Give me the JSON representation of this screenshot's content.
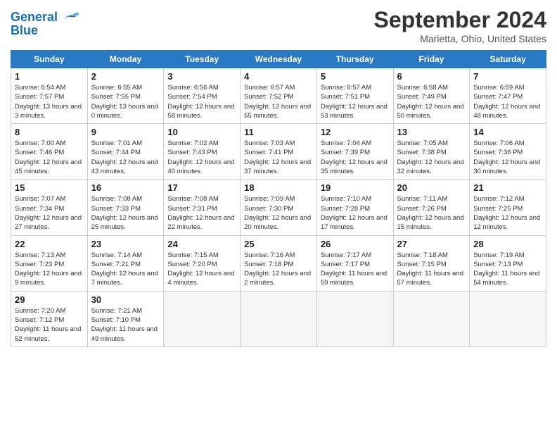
{
  "header": {
    "logo_line1": "General",
    "logo_line2": "Blue",
    "month_title": "September 2024",
    "location": "Marietta, Ohio, United States"
  },
  "days_of_week": [
    "Sunday",
    "Monday",
    "Tuesday",
    "Wednesday",
    "Thursday",
    "Friday",
    "Saturday"
  ],
  "weeks": [
    [
      {
        "day": 1,
        "sunrise": "6:54 AM",
        "sunset": "7:57 PM",
        "daylight": "13 hours and 3 minutes."
      },
      {
        "day": 2,
        "sunrise": "6:55 AM",
        "sunset": "7:55 PM",
        "daylight": "13 hours and 0 minutes."
      },
      {
        "day": 3,
        "sunrise": "6:56 AM",
        "sunset": "7:54 PM",
        "daylight": "12 hours and 58 minutes."
      },
      {
        "day": 4,
        "sunrise": "6:57 AM",
        "sunset": "7:52 PM",
        "daylight": "12 hours and 55 minutes."
      },
      {
        "day": 5,
        "sunrise": "6:57 AM",
        "sunset": "7:51 PM",
        "daylight": "12 hours and 53 minutes."
      },
      {
        "day": 6,
        "sunrise": "6:58 AM",
        "sunset": "7:49 PM",
        "daylight": "12 hours and 50 minutes."
      },
      {
        "day": 7,
        "sunrise": "6:59 AM",
        "sunset": "7:47 PM",
        "daylight": "12 hours and 48 minutes."
      }
    ],
    [
      {
        "day": 8,
        "sunrise": "7:00 AM",
        "sunset": "7:46 PM",
        "daylight": "12 hours and 45 minutes."
      },
      {
        "day": 9,
        "sunrise": "7:01 AM",
        "sunset": "7:44 PM",
        "daylight": "12 hours and 43 minutes."
      },
      {
        "day": 10,
        "sunrise": "7:02 AM",
        "sunset": "7:43 PM",
        "daylight": "12 hours and 40 minutes."
      },
      {
        "day": 11,
        "sunrise": "7:03 AM",
        "sunset": "7:41 PM",
        "daylight": "12 hours and 37 minutes."
      },
      {
        "day": 12,
        "sunrise": "7:04 AM",
        "sunset": "7:39 PM",
        "daylight": "12 hours and 35 minutes."
      },
      {
        "day": 13,
        "sunrise": "7:05 AM",
        "sunset": "7:38 PM",
        "daylight": "12 hours and 32 minutes."
      },
      {
        "day": 14,
        "sunrise": "7:06 AM",
        "sunset": "7:36 PM",
        "daylight": "12 hours and 30 minutes."
      }
    ],
    [
      {
        "day": 15,
        "sunrise": "7:07 AM",
        "sunset": "7:34 PM",
        "daylight": "12 hours and 27 minutes."
      },
      {
        "day": 16,
        "sunrise": "7:08 AM",
        "sunset": "7:33 PM",
        "daylight": "12 hours and 25 minutes."
      },
      {
        "day": 17,
        "sunrise": "7:08 AM",
        "sunset": "7:31 PM",
        "daylight": "12 hours and 22 minutes."
      },
      {
        "day": 18,
        "sunrise": "7:09 AM",
        "sunset": "7:30 PM",
        "daylight": "12 hours and 20 minutes."
      },
      {
        "day": 19,
        "sunrise": "7:10 AM",
        "sunset": "7:28 PM",
        "daylight": "12 hours and 17 minutes."
      },
      {
        "day": 20,
        "sunrise": "7:11 AM",
        "sunset": "7:26 PM",
        "daylight": "12 hours and 15 minutes."
      },
      {
        "day": 21,
        "sunrise": "7:12 AM",
        "sunset": "7:25 PM",
        "daylight": "12 hours and 12 minutes."
      }
    ],
    [
      {
        "day": 22,
        "sunrise": "7:13 AM",
        "sunset": "7:23 PM",
        "daylight": "12 hours and 9 minutes."
      },
      {
        "day": 23,
        "sunrise": "7:14 AM",
        "sunset": "7:21 PM",
        "daylight": "12 hours and 7 minutes."
      },
      {
        "day": 24,
        "sunrise": "7:15 AM",
        "sunset": "7:20 PM",
        "daylight": "12 hours and 4 minutes."
      },
      {
        "day": 25,
        "sunrise": "7:16 AM",
        "sunset": "7:18 PM",
        "daylight": "12 hours and 2 minutes."
      },
      {
        "day": 26,
        "sunrise": "7:17 AM",
        "sunset": "7:17 PM",
        "daylight": "11 hours and 59 minutes."
      },
      {
        "day": 27,
        "sunrise": "7:18 AM",
        "sunset": "7:15 PM",
        "daylight": "11 hours and 57 minutes."
      },
      {
        "day": 28,
        "sunrise": "7:19 AM",
        "sunset": "7:13 PM",
        "daylight": "11 hours and 54 minutes."
      }
    ],
    [
      {
        "day": 29,
        "sunrise": "7:20 AM",
        "sunset": "7:12 PM",
        "daylight": "11 hours and 52 minutes."
      },
      {
        "day": 30,
        "sunrise": "7:21 AM",
        "sunset": "7:10 PM",
        "daylight": "11 hours and 49 minutes."
      },
      null,
      null,
      null,
      null,
      null
    ]
  ]
}
